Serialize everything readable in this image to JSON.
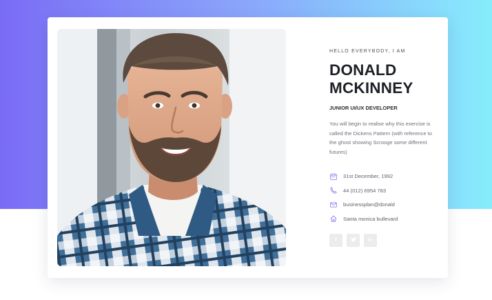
{
  "theme": {
    "accent": "#7a6cf5",
    "gradient_end": "#87ecfc",
    "text_dark": "#1d2026",
    "text_muted": "#6e717a"
  },
  "profile": {
    "greeting": "HELLO EVERYBODY, I AM",
    "first_name": "DONALD",
    "last_name": "MCKINNEY",
    "role": "JUNIOR UI/UX DEVELOPER",
    "bio": "You will begin to realise why this exercise is called the Dickens Pattern (with reference to the ghost showing Scrooge some different futures)",
    "photo_icon": "portrait-photo"
  },
  "contacts": [
    {
      "icon": "calendar-icon",
      "text": "31st December, 1992"
    },
    {
      "icon": "phone-icon",
      "text": "44 (012) 6954 783"
    },
    {
      "icon": "mail-icon",
      "text": "businessplan@donald"
    },
    {
      "icon": "home-icon",
      "text": "Santa monica bullevard"
    }
  ],
  "socials": [
    {
      "icon": "facebook-icon",
      "label": "f"
    },
    {
      "icon": "twitter-icon",
      "label": "t"
    },
    {
      "icon": "linkedin-icon",
      "label": "in"
    }
  ]
}
